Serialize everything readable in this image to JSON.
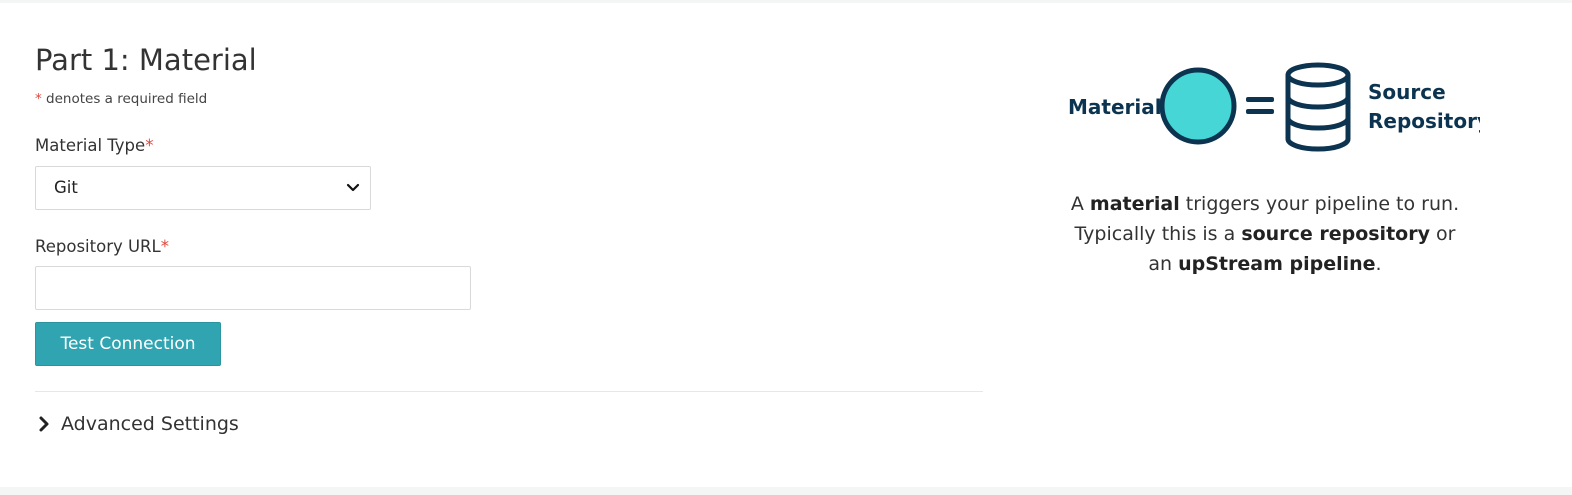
{
  "form": {
    "title": "Part 1: Material",
    "required_star": "*",
    "required_note": " denotes a required field",
    "material_type": {
      "label": "Material Type",
      "star": "*",
      "selected": "Git"
    },
    "repository_url": {
      "label": "Repository URL",
      "star": "*",
      "value": "",
      "placeholder": ""
    },
    "test_button": "Test Connection",
    "advanced_settings": "Advanced Settings"
  },
  "illustration": {
    "left_label": "Material",
    "right_label_line1": "Source",
    "right_label_line2": "Repository",
    "circle_color": "#47d6d6",
    "outline_color": "#0c3450",
    "icons": [
      "material-circle-icon",
      "equals-icon",
      "database-icon"
    ]
  },
  "description": {
    "l1_pre": "A ",
    "l1_bold": "material",
    "l1_post": " triggers your pipeline to run.",
    "l2_pre": "Typically this is a ",
    "l2_bold": "source repository",
    "l2_post": " or",
    "l3_pre": "an ",
    "l3_bold": "upStream pipeline",
    "l3_post": "."
  },
  "colors": {
    "primary_button": "#30a4b0",
    "required_star": "#e0463e"
  }
}
